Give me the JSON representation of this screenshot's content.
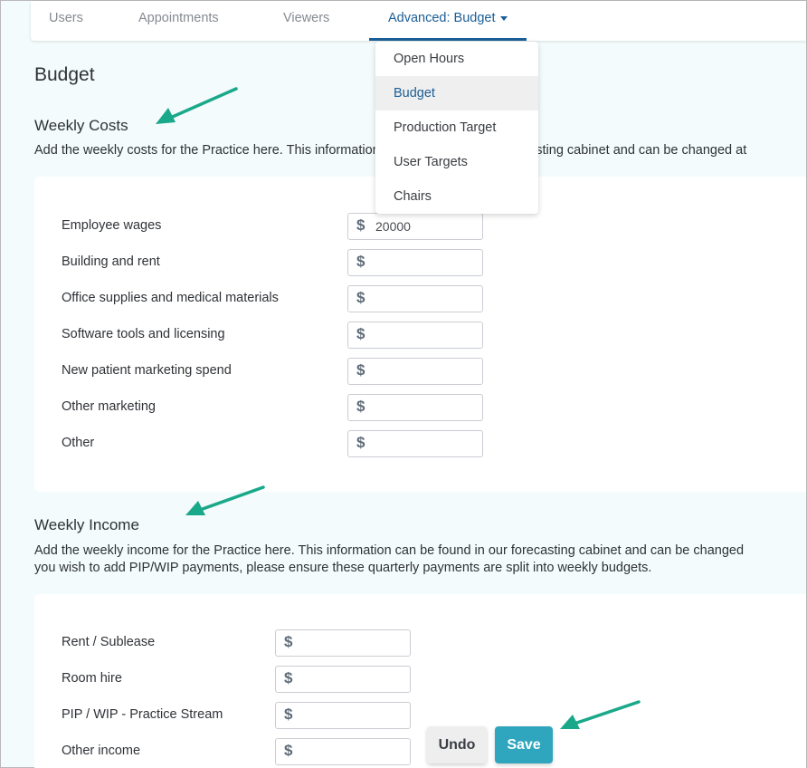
{
  "tabs": [
    {
      "label": "Users"
    },
    {
      "label": "Appointments"
    },
    {
      "label": "Viewers"
    },
    {
      "label": "Advanced: Budget"
    }
  ],
  "dropdown": {
    "items": [
      "Open Hours",
      "Budget",
      "Production Target",
      "User Targets",
      "Chairs"
    ],
    "selected": "Budget"
  },
  "page": {
    "title": "Budget"
  },
  "weekly_costs": {
    "title": "Weekly Costs",
    "description": "Add the weekly costs for the Practice here. This information can be found in our forecasting cabinet and can be changed at",
    "currency_symbol": "$",
    "rows": [
      {
        "label": "Employee wages",
        "value": "20000"
      },
      {
        "label": "Building and rent",
        "value": ""
      },
      {
        "label": "Office supplies and medical materials",
        "value": ""
      },
      {
        "label": "Software tools and licensing",
        "value": ""
      },
      {
        "label": "New patient marketing spend",
        "value": ""
      },
      {
        "label": "Other marketing",
        "value": ""
      },
      {
        "label": "Other",
        "value": ""
      }
    ]
  },
  "weekly_income": {
    "title": "Weekly Income",
    "description_line1": "Add the weekly income for the Practice here. This information can be found in our forecasting cabinet and can be changed",
    "description_line2": "you wish to add PIP/WIP payments, please ensure these quarterly payments are split into weekly budgets.",
    "currency_symbol": "$",
    "rows": [
      {
        "label": "Rent / Sublease",
        "value": ""
      },
      {
        "label": "Room hire",
        "value": ""
      },
      {
        "label": "PIP / WIP - Practice Stream",
        "value": ""
      },
      {
        "label": "Other income",
        "value": ""
      }
    ]
  },
  "actions": {
    "undo": "Undo",
    "save": "Save"
  },
  "colors": {
    "accent": "#1b5e96",
    "save": "#2fa6bd",
    "arrow": "#1aa88a",
    "background": "#f3fbfc"
  }
}
